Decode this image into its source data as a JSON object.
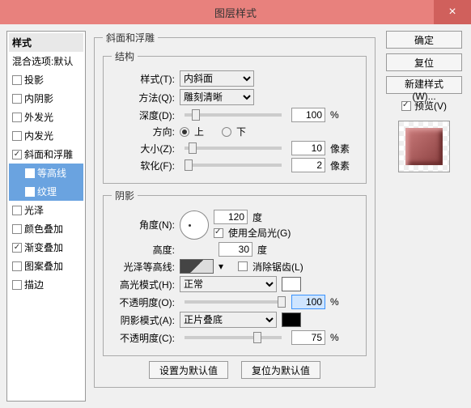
{
  "title": "图层样式",
  "sidebar": {
    "header": "样式",
    "blend": "混合选项:默认",
    "items": [
      {
        "label": "投影",
        "checked": false
      },
      {
        "label": "内阴影",
        "checked": false
      },
      {
        "label": "外发光",
        "checked": false
      },
      {
        "label": "内发光",
        "checked": false
      },
      {
        "label": "斜面和浮雕",
        "checked": true,
        "selected": false
      },
      {
        "label": "等高线",
        "checked": false,
        "sub": true,
        "selected": true
      },
      {
        "label": "纹理",
        "checked": false,
        "sub": true,
        "selected": true
      },
      {
        "label": "光泽",
        "checked": false
      },
      {
        "label": "颜色叠加",
        "checked": false
      },
      {
        "label": "渐变叠加",
        "checked": true
      },
      {
        "label": "图案叠加",
        "checked": false
      },
      {
        "label": "描边",
        "checked": false
      }
    ]
  },
  "panel": {
    "group_title": "斜面和浮雕",
    "structure": {
      "legend": "结构",
      "style_label": "样式(T):",
      "style_value": "内斜面",
      "method_label": "方法(Q):",
      "method_value": "雕刻清晰",
      "depth_label": "深度(D):",
      "depth_value": "100",
      "depth_unit": "%",
      "direction_label": "方向:",
      "dir_up": "上",
      "dir_down": "下",
      "size_label": "大小(Z):",
      "size_value": "10",
      "size_unit": "像素",
      "soften_label": "软化(F):",
      "soften_value": "2",
      "soften_unit": "像素"
    },
    "shadow": {
      "legend": "阴影",
      "angle_label": "角度(N):",
      "angle_value": "120",
      "angle_unit": "度",
      "global_light": "使用全局光(G)",
      "altitude_label": "高度:",
      "altitude_value": "30",
      "altitude_unit": "度",
      "contour_label": "光泽等高线:",
      "antialias": "消除锯齿(L)",
      "highlight_mode_label": "高光模式(H):",
      "highlight_mode_value": "正常",
      "highlight_opacity_label": "不透明度(O):",
      "highlight_opacity_value": "100",
      "shadow_mode_label": "阴影模式(A):",
      "shadow_mode_value": "正片叠底",
      "shadow_opacity_label": "不透明度(C):",
      "shadow_opacity_value": "75",
      "opacity_unit": "%"
    },
    "defaults": {
      "set": "设置为默认值",
      "reset": "复位为默认值"
    }
  },
  "right": {
    "ok": "确定",
    "reset": "复位",
    "new_style": "新建样式(W)...",
    "preview": "预览(V)"
  }
}
